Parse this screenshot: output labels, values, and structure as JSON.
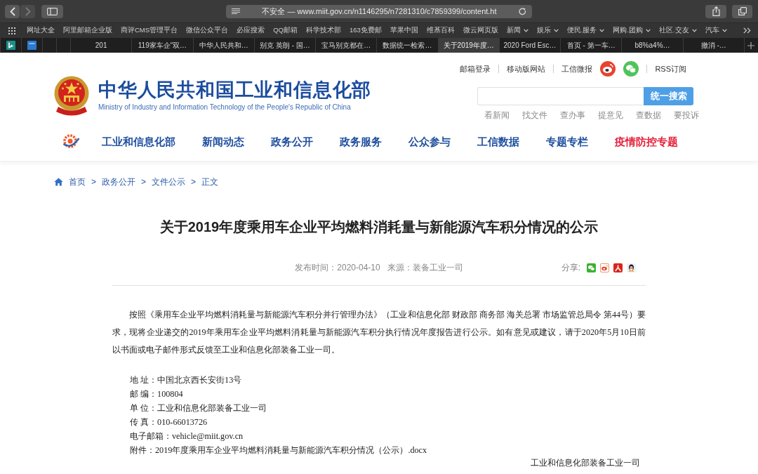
{
  "browser": {
    "nav_buttons": [
      {
        "kind": "back",
        "disabled": false
      },
      {
        "kind": "forward",
        "disabled": true
      }
    ],
    "address": "不安全 — www.miit.gov.cn/n1146295/n7281310/c7859399/content.ht",
    "bookmarks": [
      {
        "label": "网址大全",
        "folder": false
      },
      {
        "label": "阿里邮箱企业版",
        "folder": false
      },
      {
        "label": "商评CMS管理平台",
        "folder": false
      },
      {
        "label": "微信公众平台",
        "folder": false
      },
      {
        "label": "必应搜索",
        "folder": false
      },
      {
        "label": "QQ邮箱",
        "folder": false
      },
      {
        "label": "科学技术部",
        "folder": false
      },
      {
        "label": "163免费邮",
        "folder": false
      },
      {
        "label": "苹果中国",
        "folder": false
      },
      {
        "label": "维基百科",
        "folder": false
      },
      {
        "label": "微云网页版",
        "folder": false
      },
      {
        "label": "新闻",
        "folder": true
      },
      {
        "label": "娱乐",
        "folder": true
      },
      {
        "label": "便民.服务",
        "folder": true
      },
      {
        "label": "网购.团购",
        "folder": true
      },
      {
        "label": "社区.交友",
        "folder": true
      },
      {
        "label": "汽车",
        "folder": true
      }
    ],
    "tabs": [
      {
        "kind": "pinned",
        "selected": false
      },
      {
        "kind": "pinned",
        "selected": false
      },
      {
        "kind": "blank",
        "selected": false
      },
      {
        "kind": "blank",
        "selected": false
      },
      {
        "kind": "page",
        "label": "201",
        "selected": false
      },
      {
        "kind": "page",
        "label": "119家车企“双…",
        "selected": false
      },
      {
        "kind": "page",
        "label": "中华人民共和…",
        "selected": false
      },
      {
        "kind": "page",
        "label": "别克 英朗 - 国…",
        "selected": false
      },
      {
        "kind": "page",
        "label": "宝马别克都在…",
        "selected": false
      },
      {
        "kind": "page",
        "label": "数据统一检索…",
        "selected": false
      },
      {
        "kind": "page",
        "label": "关于2019年度…",
        "selected": true
      },
      {
        "kind": "page",
        "label": "2020 Ford Esc…",
        "selected": false
      },
      {
        "kind": "page",
        "label": "首页 - 第一车…",
        "selected": false
      },
      {
        "kind": "page",
        "label": "b8%a4%…",
        "selected": false
      },
      {
        "kind": "page",
        "label": "撤消 -…",
        "selected": false
      }
    ]
  },
  "site": {
    "title": "中华人民共和国工业和信息化部",
    "subtitle": "Ministry of Industry and Information Technology of the People's Republic of China",
    "top_links": [
      {
        "kind": "link",
        "label": "邮箱登录"
      },
      {
        "kind": "link",
        "label": "移动版网站"
      },
      {
        "kind": "link",
        "label": "工信微报"
      },
      {
        "kind": "microblog"
      },
      {
        "kind": "chat"
      },
      {
        "kind": "link",
        "label": "RSS订阅"
      }
    ],
    "search": {
      "button": "统一搜索"
    },
    "quick_links": [
      "看新闻",
      "找文件",
      "查办事",
      "提意见",
      "查数据",
      "要投诉"
    ],
    "nav": [
      {
        "label": "工业和信息化部",
        "color": "#1f4f9f"
      },
      {
        "label": "新闻动态",
        "color": "#1f4f9f"
      },
      {
        "label": "政务公开",
        "color": "#1f4f9f"
      },
      {
        "label": "政务服务",
        "color": "#1f4f9f"
      },
      {
        "label": "公众参与",
        "color": "#1f4f9f"
      },
      {
        "label": "工信数据",
        "color": "#1f4f9f"
      },
      {
        "label": "专题专栏",
        "color": "#1f4f9f"
      },
      {
        "label": "疫情防控专题",
        "color": "#e5213c"
      }
    ]
  },
  "breadcrumb": {
    "items": [
      "首页",
      "政务公开",
      "文件公示",
      "正文"
    ],
    "separator": ">"
  },
  "article": {
    "title": "关于2019年度乘用车企业平均燃料消耗量与新能源汽车积分情况的公示",
    "published": "发布时间：2020-04-10",
    "source": "来源：装备工业一司",
    "share": {
      "label": "分享:",
      "buttons": [
        {
          "kind": "chat"
        },
        {
          "kind": "microblog"
        },
        {
          "kind": "person"
        },
        {
          "kind": "penguin"
        }
      ]
    },
    "paragraph": "按照《乘用车企业平均燃料消耗量与新能源汽车积分并行管理办法》（工业和信息化部 财政部 商务部 海关总署 市场监管总局令 第44号）要求，现将企业递交的2019年乘用车企业平均燃料消耗量与新能源汽车积分执行情况年度报告进行公示。如有意见或建议，请于2020年5月10日前以书面或电子邮件形式反馈至工业和信息化部装备工业一司。",
    "contacts": [
      {
        "label": "地 址：",
        "value": "中国北京西长安街13号"
      },
      {
        "label": "邮 编：",
        "value": "100804"
      },
      {
        "label": "单 位：",
        "value": "工业和信息化部装备工业一司"
      },
      {
        "label": "传 真：",
        "value": "010-66013726"
      },
      {
        "label": "电子邮箱：",
        "value": "vehicle@miit.gov.cn"
      },
      {
        "label": "附件：",
        "value": "2019年度乘用车企业平均燃料消耗量与新能源汽车积分情况（公示）.docx"
      }
    ],
    "signature": "工业和信息化部装备工业一司"
  }
}
